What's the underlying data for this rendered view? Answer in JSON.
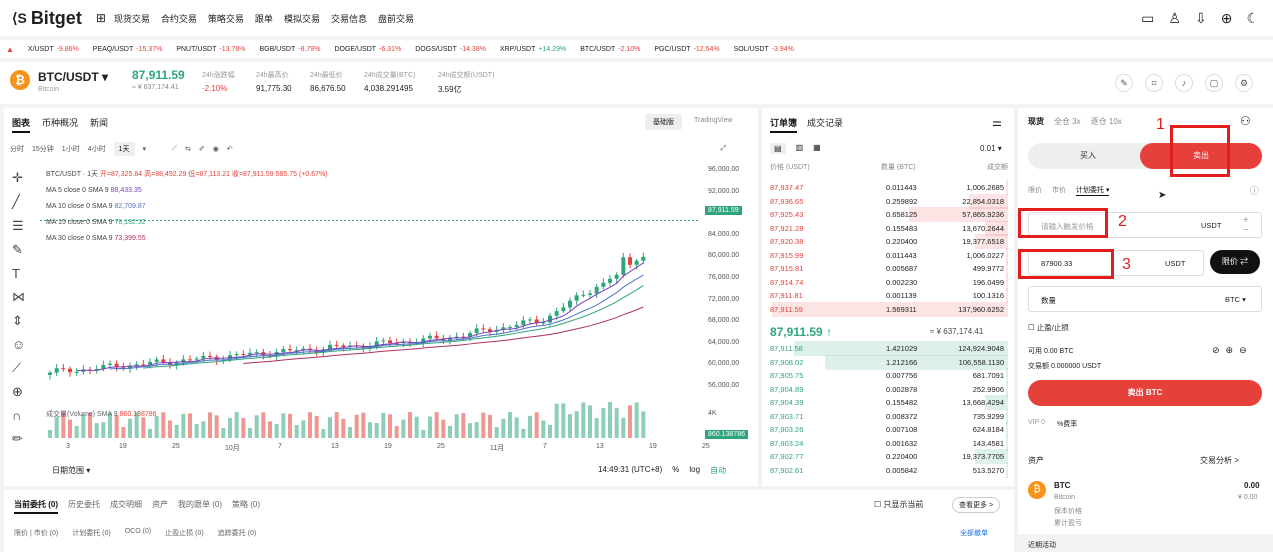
{
  "nav": {
    "logo": "Bitget",
    "items": [
      "现货交易",
      "合约交易",
      "策略交易",
      "跟单",
      "模拟交易",
      "交易信息",
      "盘前交易"
    ]
  },
  "ticker": [
    {
      "sym": "X/USDT",
      "chg": "-9.86%",
      "dir": "neg"
    },
    {
      "sym": "PEAQ/USDT",
      "chg": "-15.37%",
      "dir": "neg"
    },
    {
      "sym": "PNUT/USDT",
      "chg": "-13.78%",
      "dir": "neg"
    },
    {
      "sym": "BGB/USDT",
      "chg": "-8.79%",
      "dir": "neg"
    },
    {
      "sym": "DOGE/USDT",
      "chg": "-6.31%",
      "dir": "neg"
    },
    {
      "sym": "DOGS/USDT",
      "chg": "-14.38%",
      "dir": "neg"
    },
    {
      "sym": "XRP/USDT",
      "chg": "+14.29%",
      "dir": "pos"
    },
    {
      "sym": "BTC/USDT",
      "chg": "-2.10%",
      "dir": "neg"
    },
    {
      "sym": "PGC/USDT",
      "chg": "-12.54%",
      "dir": "neg"
    },
    {
      "sym": "SOL/USDT",
      "chg": "-3.94%",
      "dir": "neg"
    }
  ],
  "pair": {
    "name": "BTC/USDT",
    "sub": "Bitcoin",
    "last": "87,911.59",
    "last_sub": "≈ ¥ 637,174.41"
  },
  "stats": [
    {
      "label": "24h涨跌幅",
      "value": "-2.10%"
    },
    {
      "label": "24h最高价",
      "value": "91,775.30"
    },
    {
      "label": "24h最低价",
      "value": "86,676.50"
    },
    {
      "label": "24h成交量(BTC)",
      "value": "4,038.291495"
    },
    {
      "label": "24h成交额(USDT)",
      "value": "3.59亿"
    }
  ],
  "chart_tabs": [
    "图表",
    "币种概况",
    "新闻"
  ],
  "view_switch": [
    "基础版",
    "TradingView"
  ],
  "timeframes": [
    "分时",
    "15分钟",
    "1小时",
    "4小时",
    "1天"
  ],
  "legend": {
    "title": "BTC/USDT · 1天",
    "ohlc": "开=87,325.84 高=88,492.29 低=87,113.21 收=87,911.59 585.75 (+0.67%)",
    "ma": [
      {
        "label": "MA 5 close 0 SMA 9",
        "value": "88,433.35",
        "color": "#7b3fbf"
      },
      {
        "label": "MA 10 close 0 SMA 9",
        "value": "82,709.87",
        "color": "#4b73c9"
      },
      {
        "label": "MA 15 close 0 SMA 9",
        "value": "78,132.32",
        "color": "#2ea57a"
      },
      {
        "label": "MA 30 close 0 SMA 9",
        "value": "73,399.55",
        "color": "#b03060"
      }
    ],
    "vol": "成交量(Volume) SMA 9",
    "vol_value": "860.138786"
  },
  "chart_data": {
    "type": "candlestick",
    "y_ticks": [
      "96,000.00",
      "92,000.00",
      "88,000.00",
      "84,000.00",
      "80,000.00",
      "76,000.00",
      "72,000.00",
      "68,000.00",
      "64,000.00",
      "60,000.00",
      "56,000.00"
    ],
    "x_ticks": [
      "3",
      "19",
      "25",
      "10月",
      "7",
      "13",
      "19",
      "25",
      "11月",
      "7",
      "13",
      "19",
      "25"
    ],
    "last_price_tag": "87,911.59",
    "volume_axis": {
      "tick": "4K",
      "last": "860.138786"
    }
  },
  "chart_footer": {
    "range": "日期范围",
    "time": "14:49:31 (UTC+8)",
    "pct": "%",
    "log": "log",
    "auto": "自动"
  },
  "orderbook": {
    "tabs": [
      "订单簿",
      "成交记录"
    ],
    "precision": "0.01",
    "headers": [
      "价格 (USDT)",
      "数量 (BTC)",
      "成交额"
    ],
    "asks": [
      [
        "87,937.47",
        "0.011443",
        "1,006.2685"
      ],
      [
        "87,936.65",
        "0.259892",
        "22,854.0318"
      ],
      [
        "87,925.43",
        "0.658125",
        "57,865.9236"
      ],
      [
        "87,921.28",
        "0.155483",
        "13,670.2644"
      ],
      [
        "87,920.38",
        "0.220400",
        "19,377.6518"
      ],
      [
        "87,915.99",
        "0.011443",
        "1,006.0227"
      ],
      [
        "87,915.81",
        "0.005687",
        "499.9772"
      ],
      [
        "87,914.74",
        "0.002230",
        "196.0499"
      ],
      [
        "87,911.81",
        "0.001139",
        "100.1316"
      ],
      [
        "87,911.59",
        "1.569311",
        "137,960.6252"
      ]
    ],
    "mid": "87,911.59",
    "mid_arrow": "↑",
    "mid_ref": "≈ ¥ 637,174.41",
    "bids": [
      [
        "87,911.58",
        "1.421029",
        "124,924.9048"
      ],
      [
        "87,908.02",
        "1.212166",
        "106,558.1130"
      ],
      [
        "87,905.75",
        "0.007756",
        "681.7091"
      ],
      [
        "87,904.89",
        "0.002878",
        "252.9906"
      ],
      [
        "87,904.39",
        "0.155482",
        "13,668.4294"
      ],
      [
        "87,903.71",
        "0.008372",
        "735.9299"
      ],
      [
        "87,903.26",
        "0.007108",
        "624.8184"
      ],
      [
        "87,903.24",
        "0.001632",
        "143.4581"
      ],
      [
        "87,902.77",
        "0.220400",
        "19,373.7705"
      ],
      [
        "87,902.61",
        "0.005842",
        "513.5270"
      ]
    ]
  },
  "trade": {
    "tabs": [
      "现货",
      "全仓 3x",
      "逐仓 10x"
    ],
    "buy": "买入",
    "sell": "卖出",
    "order_types": [
      "限价",
      "市价",
      "计划委托 ▾"
    ],
    "trigger_placeholder": "请输入触发价格",
    "trigger_unit": "USDT",
    "price_value": "87900.33",
    "price_unit": "USDT",
    "limit_btn": "限价 ⇄",
    "qty_label": "数量",
    "qty_unit": "BTC ▾",
    "tpsl": "止盈/止损",
    "avail": "可用 0.00 BTC",
    "deal": "交易额 0.000000 USDT",
    "sell_btc": "卖出 BTC",
    "vip": "VIP 0",
    "fee": "%费率",
    "assets": "资产",
    "analysis": "交易分析 >",
    "asset_coin": "BTC",
    "asset_name": "Bitcoin",
    "asset_amt": "0.00",
    "asset_cny": "¥ 0.00",
    "margin_label": "保本价格",
    "margin2": "累计盈亏",
    "promo": "近期活动"
  },
  "annotations": [
    "1",
    "2",
    "3"
  ],
  "orders": {
    "tabs": [
      "当前委托 (0)",
      "历史委托",
      "成交明细",
      "资产",
      "我的跟单 (0)",
      "策略 (0)"
    ],
    "show_current": "只显示当前",
    "more": "查看更多 >",
    "sub": [
      "限价 | 市价 (0)",
      "计划委托 (0)",
      "OCO (0)",
      "止盈止损 (0)",
      "追踪委托 (0)"
    ],
    "cancel_all": "全部撤单"
  }
}
